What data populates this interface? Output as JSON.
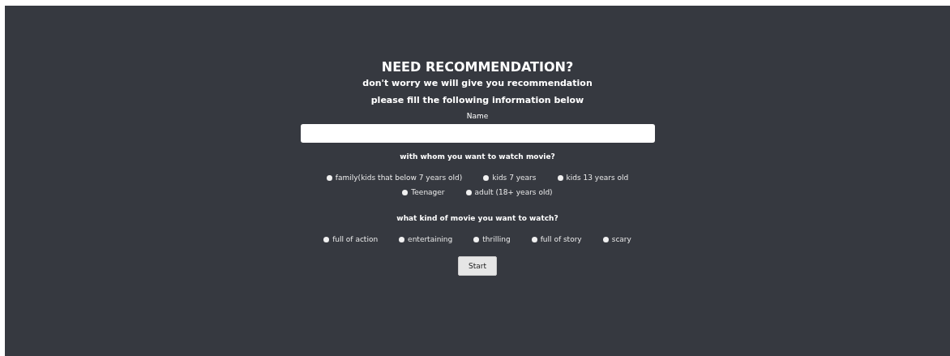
{
  "title": "NEED RECOMMENDATION?",
  "subtitles": [
    "don't worry we will give you recommendation",
    "please fill the following information below"
  ],
  "name_field": {
    "label": "Name"
  },
  "questions": [
    {
      "label": "with whom you want to watch movie?",
      "rows": [
        [
          {
            "label": "family(kids that below 7 years old)",
            "selected": false
          },
          {
            "label": "kids 7 years",
            "selected": false
          },
          {
            "label": "kids 13 years old",
            "selected": false
          }
        ],
        [
          {
            "label": "Teenager",
            "selected": false
          },
          {
            "label": "adult (18+ years old)",
            "selected": false
          }
        ]
      ]
    },
    {
      "label": "what kind of movie you want to watch?",
      "rows": [
        [
          {
            "label": "full of action",
            "selected": false
          },
          {
            "label": "entertaining",
            "selected": false
          },
          {
            "label": "thrilling",
            "selected": false
          },
          {
            "label": "full of story",
            "selected": false
          },
          {
            "label": "scary",
            "selected": false
          }
        ]
      ]
    }
  ],
  "button": "Start"
}
